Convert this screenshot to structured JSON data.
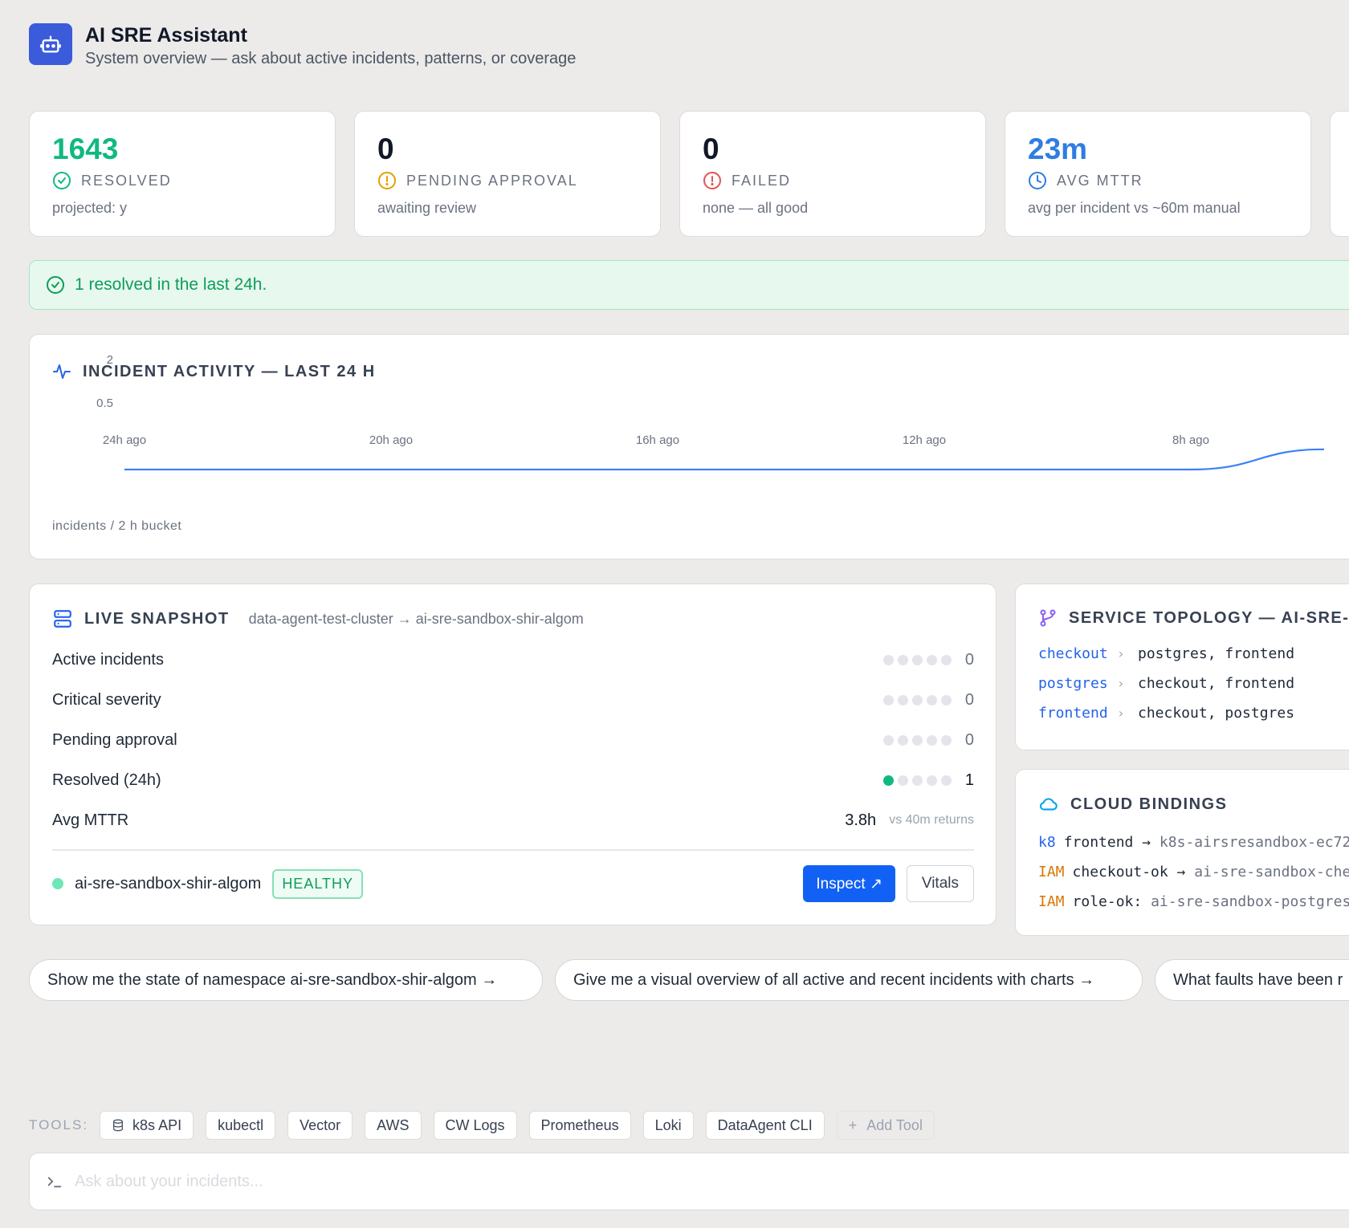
{
  "header": {
    "title": "AI SRE Assistant",
    "subtitle": "System overview — ask about active incidents, patterns, or coverage",
    "logo_icon": "robot-icon"
  },
  "stats": [
    {
      "value": "1643",
      "label": "RESOLVED",
      "sub": "projected: y",
      "color": "#10b981",
      "icon": "check-circle-icon"
    },
    {
      "value": "0",
      "label": "PENDING APPROVAL",
      "sub": "awaiting review",
      "color": "#111827",
      "icon": "alert-circle-icon"
    },
    {
      "value": "0",
      "label": "FAILED",
      "sub": "none — all good",
      "color": "#111827",
      "icon": "x-circle-icon"
    },
    {
      "value": "23m",
      "label": "AVG MTTR",
      "sub": "avg per incident vs ~60m manual",
      "color": "#2f7de1",
      "icon": "clock-icon"
    }
  ],
  "banner": {
    "text": "1 resolved in the last 24h."
  },
  "chart_data": {
    "type": "line",
    "title": "INCIDENT ACTIVITY — LAST 24 H",
    "ylabel": "incidents / 2 h bucket",
    "x_ticks": [
      "24h ago",
      "20h ago",
      "16h ago",
      "12h ago",
      "8h ago"
    ],
    "y_ticks": [
      "2",
      "0.5"
    ],
    "series": [
      {
        "x": [
          "24h ago",
          "22h ago",
          "20h ago",
          "18h ago",
          "16h ago",
          "14h ago",
          "12h ago",
          "10h ago",
          "8h ago",
          "6h ago"
        ],
        "values": [
          0,
          0,
          0,
          0,
          0,
          0,
          0,
          0,
          0,
          0.6
        ],
        "color": "#3b82f6"
      }
    ]
  },
  "snapshot": {
    "title": "LIVE SNAPSHOT",
    "path": "data-agent-test-cluster → ai-sre-sandbox-shir-algom",
    "rows": [
      {
        "name": "Active incidents",
        "value": "0",
        "filled": 0
      },
      {
        "name": "Critical severity",
        "value": "0",
        "filled": 0
      },
      {
        "name": "Pending approval",
        "value": "0",
        "filled": 0
      },
      {
        "name": "Resolved (24h)",
        "value": "1",
        "filled": 1
      }
    ],
    "mttr": {
      "name": "Avg MTTR",
      "value": "3.8h",
      "note": "vs 40m returns"
    },
    "namespace": "ai-sre-sandbox-shir-algom",
    "status": "HEALTHY",
    "inspect_label": "Inspect ↗",
    "vitals_label": "Vitals"
  },
  "topology": {
    "title": "SERVICE TOPOLOGY — AI-SRE-SA",
    "rows": [
      {
        "service": "checkout",
        "deps": "postgres, frontend"
      },
      {
        "service": "postgres",
        "deps": "checkout, frontend"
      },
      {
        "service": "frontend",
        "deps": "checkout, postgres"
      }
    ]
  },
  "cloud": {
    "title": "CLOUD BINDINGS",
    "rows": [
      {
        "kind": "k8",
        "src": "frontend →",
        "dst": "k8s-airsresandbox-ec72"
      },
      {
        "kind": "IAM",
        "src": "checkout-ok →",
        "dst": "ai-sre-sandbox-che"
      },
      {
        "kind": "IAM",
        "src": "role-ok:",
        "dst": "ai-sre-sandbox-postgres"
      }
    ]
  },
  "suggestions": [
    "Show me the state of namespace ai-sre-sandbox-shir-algom →",
    "Give me a visual overview of all active and recent incidents with charts →",
    "What faults have been r"
  ],
  "tools": {
    "label": "TOOLS:",
    "items": [
      "k8s API",
      "kubectl",
      "Vector",
      "AWS",
      "CW Logs",
      "Prometheus",
      "Loki",
      "DataAgent CLI"
    ],
    "add_label": "Add Tool"
  },
  "prompt": {
    "placeholder": "Ask about your incidents..."
  }
}
